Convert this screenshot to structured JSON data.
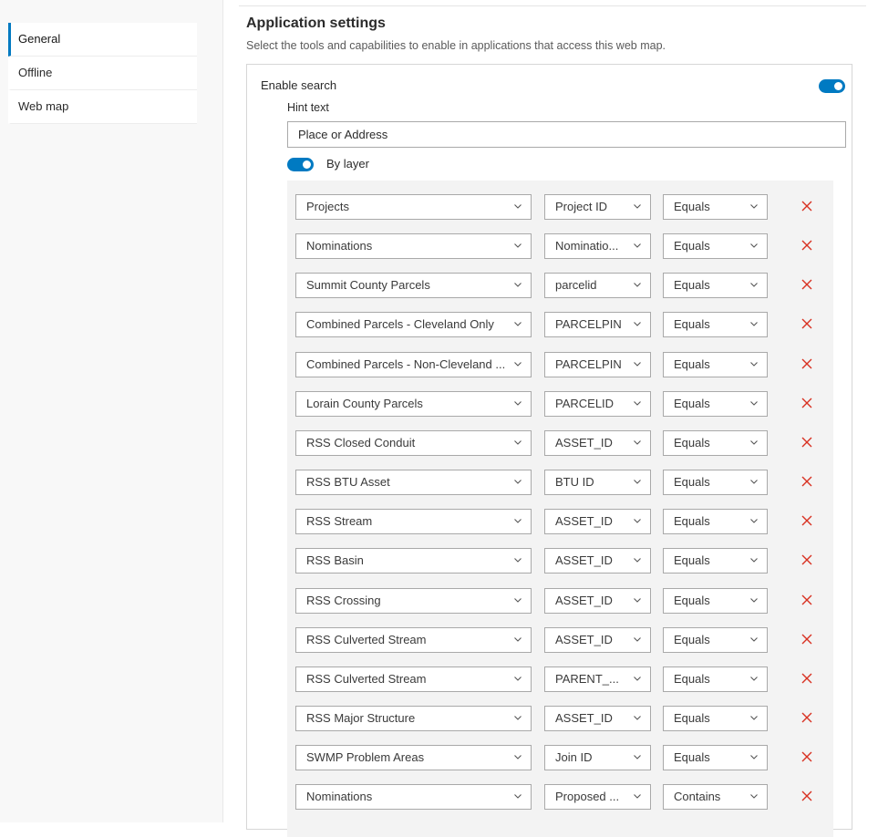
{
  "sidebar": {
    "items": [
      {
        "label": "General",
        "active": true
      },
      {
        "label": "Offline",
        "active": false
      },
      {
        "label": "Web map",
        "active": false
      }
    ]
  },
  "main": {
    "title": "Application settings",
    "description": "Select the tools and capabilities to enable in applications that access this web map.",
    "search": {
      "enable_label": "Enable search",
      "enabled": true,
      "hint_label": "Hint text",
      "hint_value": "Place or Address",
      "by_layer_label": "By layer",
      "by_layer_enabled": true
    },
    "layer_rows": [
      {
        "layer": "Projects",
        "field": "Project ID",
        "operator": "Equals"
      },
      {
        "layer": "Nominations",
        "field": "Nominatio...",
        "operator": "Equals"
      },
      {
        "layer": "Summit County Parcels",
        "field": "parcelid",
        "operator": "Equals"
      },
      {
        "layer": "Combined Parcels - Cleveland Only",
        "field": "PARCELPIN",
        "operator": "Equals"
      },
      {
        "layer": "Combined Parcels - Non-Cleveland ...",
        "field": "PARCELPIN",
        "operator": "Equals"
      },
      {
        "layer": "Lorain County Parcels",
        "field": "PARCELID",
        "operator": "Equals"
      },
      {
        "layer": "RSS Closed Conduit",
        "field": "ASSET_ID",
        "operator": "Equals"
      },
      {
        "layer": "RSS BTU Asset",
        "field": "BTU ID",
        "operator": "Equals"
      },
      {
        "layer": "RSS Stream",
        "field": "ASSET_ID",
        "operator": "Equals"
      },
      {
        "layer": "RSS Basin",
        "field": "ASSET_ID",
        "operator": "Equals"
      },
      {
        "layer": "RSS Crossing",
        "field": "ASSET_ID",
        "operator": "Equals"
      },
      {
        "layer": "RSS Culverted Stream",
        "field": "ASSET_ID",
        "operator": "Equals"
      },
      {
        "layer": "RSS Culverted Stream",
        "field": "PARENT_...",
        "operator": "Equals"
      },
      {
        "layer": "RSS Major Structure",
        "field": "ASSET_ID",
        "operator": "Equals"
      },
      {
        "layer": "SWMP Problem Areas",
        "field": "Join ID",
        "operator": "Equals"
      },
      {
        "layer": "Nominations",
        "field": "Proposed ...",
        "operator": "Contains"
      }
    ]
  },
  "colors": {
    "accent": "#007ac2",
    "delete": "#d83020"
  },
  "icons": {
    "chevron": "chevron-down-icon",
    "delete": "x-icon"
  }
}
